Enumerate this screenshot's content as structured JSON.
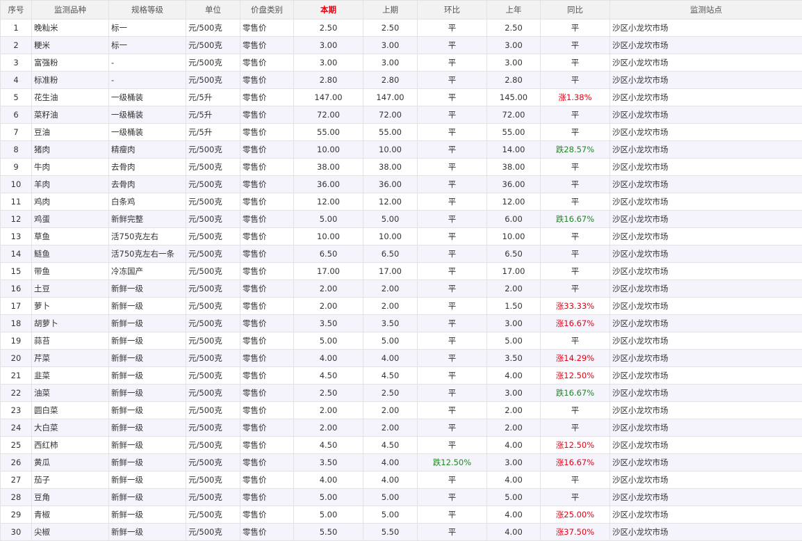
{
  "headers": [
    "序号",
    "监测品种",
    "规格等级",
    "单位",
    "价盘类别",
    "本期",
    "上期",
    "环比",
    "上年",
    "同比",
    "监测站点"
  ],
  "rows": [
    [
      "1",
      "晚籼米",
      "标一",
      "元/500克",
      "零售价",
      "2.50",
      "2.50",
      "平",
      "2.50",
      "平",
      "沙区小龙坎市场"
    ],
    [
      "2",
      "粳米",
      "标一",
      "元/500克",
      "零售价",
      "3.00",
      "3.00",
      "平",
      "3.00",
      "平",
      "沙区小龙坎市场"
    ],
    [
      "3",
      "富强粉",
      "-",
      "元/500克",
      "零售价",
      "3.00",
      "3.00",
      "平",
      "3.00",
      "平",
      "沙区小龙坎市场"
    ],
    [
      "4",
      "标准粉",
      "-",
      "元/500克",
      "零售价",
      "2.80",
      "2.80",
      "平",
      "2.80",
      "平",
      "沙区小龙坎市场"
    ],
    [
      "5",
      "花生油",
      "一级桶装",
      "元/5升",
      "零售价",
      "147.00",
      "147.00",
      "平",
      "145.00",
      "涨1.38%",
      "沙区小龙坎市场"
    ],
    [
      "6",
      "菜籽油",
      "一级桶装",
      "元/5升",
      "零售价",
      "72.00",
      "72.00",
      "平",
      "72.00",
      "平",
      "沙区小龙坎市场"
    ],
    [
      "7",
      "豆油",
      "一级桶装",
      "元/5升",
      "零售价",
      "55.00",
      "55.00",
      "平",
      "55.00",
      "平",
      "沙区小龙坎市场"
    ],
    [
      "8",
      "猪肉",
      "精瘦肉",
      "元/500克",
      "零售价",
      "10.00",
      "10.00",
      "平",
      "14.00",
      "跌28.57%",
      "沙区小龙坎市场"
    ],
    [
      "9",
      "牛肉",
      "去骨肉",
      "元/500克",
      "零售价",
      "38.00",
      "38.00",
      "平",
      "38.00",
      "平",
      "沙区小龙坎市场"
    ],
    [
      "10",
      "羊肉",
      "去骨肉",
      "元/500克",
      "零售价",
      "36.00",
      "36.00",
      "平",
      "36.00",
      "平",
      "沙区小龙坎市场"
    ],
    [
      "11",
      "鸡肉",
      "白条鸡",
      "元/500克",
      "零售价",
      "12.00",
      "12.00",
      "平",
      "12.00",
      "平",
      "沙区小龙坎市场"
    ],
    [
      "12",
      "鸡蛋",
      "新鲜完整",
      "元/500克",
      "零售价",
      "5.00",
      "5.00",
      "平",
      "6.00",
      "跌16.67%",
      "沙区小龙坎市场"
    ],
    [
      "13",
      "草鱼",
      "活750克左右",
      "元/500克",
      "零售价",
      "10.00",
      "10.00",
      "平",
      "10.00",
      "平",
      "沙区小龙坎市场"
    ],
    [
      "14",
      "鲢鱼",
      "活750克左右一条",
      "元/500克",
      "零售价",
      "6.50",
      "6.50",
      "平",
      "6.50",
      "平",
      "沙区小龙坎市场"
    ],
    [
      "15",
      "带鱼",
      "冷冻国产",
      "元/500克",
      "零售价",
      "17.00",
      "17.00",
      "平",
      "17.00",
      "平",
      "沙区小龙坎市场"
    ],
    [
      "16",
      "土豆",
      "新鲜一级",
      "元/500克",
      "零售价",
      "2.00",
      "2.00",
      "平",
      "2.00",
      "平",
      "沙区小龙坎市场"
    ],
    [
      "17",
      "萝卜",
      "新鲜一级",
      "元/500克",
      "零售价",
      "2.00",
      "2.00",
      "平",
      "1.50",
      "涨33.33%",
      "沙区小龙坎市场"
    ],
    [
      "18",
      "胡萝卜",
      "新鲜一级",
      "元/500克",
      "零售价",
      "3.50",
      "3.50",
      "平",
      "3.00",
      "涨16.67%",
      "沙区小龙坎市场"
    ],
    [
      "19",
      "蒜苔",
      "新鲜一级",
      "元/500克",
      "零售价",
      "5.00",
      "5.00",
      "平",
      "5.00",
      "平",
      "沙区小龙坎市场"
    ],
    [
      "20",
      "芹菜",
      "新鲜一级",
      "元/500克",
      "零售价",
      "4.00",
      "4.00",
      "平",
      "3.50",
      "涨14.29%",
      "沙区小龙坎市场"
    ],
    [
      "21",
      "韭菜",
      "新鲜一级",
      "元/500克",
      "零售价",
      "4.50",
      "4.50",
      "平",
      "4.00",
      "涨12.50%",
      "沙区小龙坎市场"
    ],
    [
      "22",
      "油菜",
      "新鲜一级",
      "元/500克",
      "零售价",
      "2.50",
      "2.50",
      "平",
      "3.00",
      "跌16.67%",
      "沙区小龙坎市场"
    ],
    [
      "23",
      "圆白菜",
      "新鲜一级",
      "元/500克",
      "零售价",
      "2.00",
      "2.00",
      "平",
      "2.00",
      "平",
      "沙区小龙坎市场"
    ],
    [
      "24",
      "大白菜",
      "新鲜一级",
      "元/500克",
      "零售价",
      "2.00",
      "2.00",
      "平",
      "2.00",
      "平",
      "沙区小龙坎市场"
    ],
    [
      "25",
      "西红柿",
      "新鲜一级",
      "元/500克",
      "零售价",
      "4.50",
      "4.50",
      "平",
      "4.00",
      "涨12.50%",
      "沙区小龙坎市场"
    ],
    [
      "26",
      "黄瓜",
      "新鲜一级",
      "元/500克",
      "零售价",
      "3.50",
      "4.00",
      "跌12.50%",
      "3.00",
      "涨16.67%",
      "沙区小龙坎市场"
    ],
    [
      "27",
      "茄子",
      "新鲜一级",
      "元/500克",
      "零售价",
      "4.00",
      "4.00",
      "平",
      "4.00",
      "平",
      "沙区小龙坎市场"
    ],
    [
      "28",
      "豆角",
      "新鲜一级",
      "元/500克",
      "零售价",
      "5.00",
      "5.00",
      "平",
      "5.00",
      "平",
      "沙区小龙坎市场"
    ],
    [
      "29",
      "青椒",
      "新鲜一级",
      "元/500克",
      "零售价",
      "5.00",
      "5.00",
      "平",
      "4.00",
      "涨25.00%",
      "沙区小龙坎市场"
    ],
    [
      "30",
      "尖椒",
      "新鲜一级",
      "元/500克",
      "零售价",
      "5.50",
      "5.50",
      "平",
      "4.00",
      "涨37.50%",
      "沙区小龙坎市场"
    ]
  ],
  "colors": {
    "up": "#e60012",
    "down": "#1a8a1a",
    "header_highlight": "#e60012"
  }
}
